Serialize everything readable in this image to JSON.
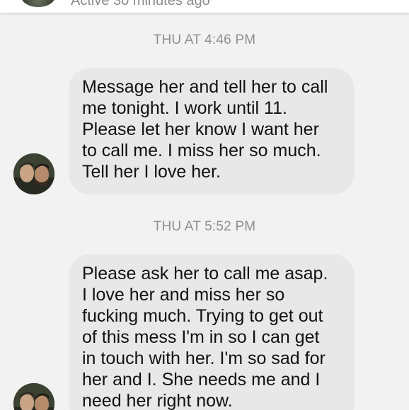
{
  "header": {
    "status": "Active 30 minutes ago"
  },
  "messages": [
    {
      "timestamp": "THU AT 4:46 PM",
      "lines": [
        "Message her and tell her to call",
        "me tonight. I work until 11.",
        "Please let her know I want her",
        "to call me. I miss her so much.",
        "Tell her I love her."
      ]
    },
    {
      "timestamp": "THU AT 5:52 PM",
      "lines": [
        "Please ask her to call me asap.",
        "I love her and miss her so",
        "fucking much. Trying to get out",
        "of this mess I'm in so I can get",
        "in touch with her. I'm so sad for",
        "her and I. She needs me and I",
        "need her right now."
      ]
    }
  ]
}
